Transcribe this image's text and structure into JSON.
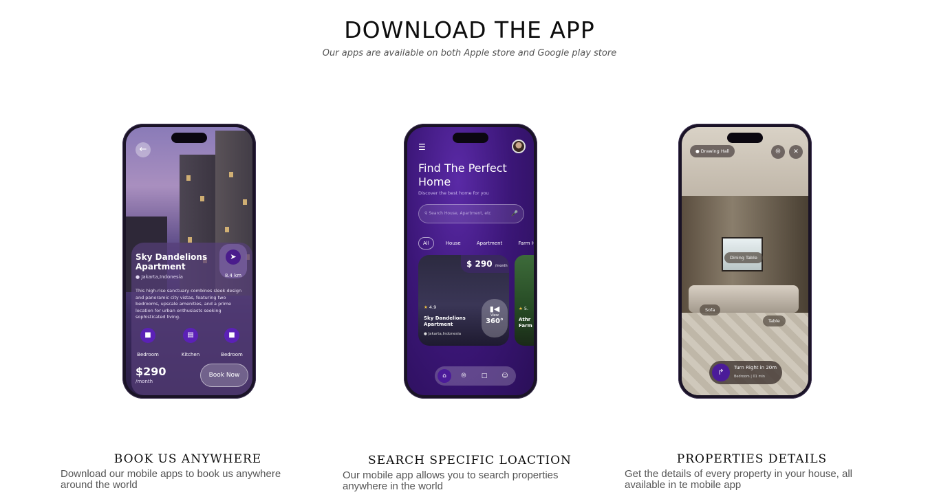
{
  "header": {
    "title": "DOWNLOAD THE APP",
    "subtitle": "Our apps are available on both Apple store and Google play store"
  },
  "phone1": {
    "back_icon": "back-arrow-icon",
    "property_name": "Sky Dandelions Apartment",
    "location": "Jakarta,Indonesia",
    "distance": "8.4 km",
    "description": "This high-rise sanctuary combines sleek design and panoramic city vistas, featuring two bedrooms, upscale amenities, and a prime location for urban enthusiasts seeking sophisticated living.",
    "amenities": [
      {
        "label": "Bedroom",
        "icon": "bed-icon"
      },
      {
        "label": "Kitchen",
        "icon": "kitchen-icon"
      },
      {
        "label": "Bedroom",
        "icon": "bed-icon"
      }
    ],
    "price": "$290",
    "per": "/month",
    "book_label": "Book Now"
  },
  "phone2": {
    "title": "Find The Perfect Home",
    "subtitle": "Discover the best home for you",
    "search_placeholder": "Search House, Apartment, etc",
    "chips": [
      "All",
      "House",
      "Apartment",
      "Farm Hou"
    ],
    "card": {
      "price": "$ 290",
      "per": "/month",
      "rating": "4.9",
      "name": "Sky Dandelions Apartment",
      "location": "Jakarta,Indonesia",
      "view_label": "View",
      "view_value": "360°"
    },
    "card2": {
      "rating": "5.",
      "name": "Athr Farm"
    },
    "nav_icons": [
      "home-icon",
      "compass-icon",
      "chat-icon",
      "user-icon"
    ]
  },
  "phone3": {
    "location_chip": "Drawing Hall",
    "tags": [
      "Dining Table",
      "Sofa",
      "Table"
    ],
    "direction_text": "Turn Right in 20m",
    "direction_room": "Bedroom",
    "direction_time": "01 min"
  },
  "features": [
    {
      "title": "BOOK US ANYWHERE",
      "desc": "Download our mobile apps to book us anywhere around the world"
    },
    {
      "title": "SEARCH SPECIFIC LOACTION",
      "desc": "Our mobile app allows you to search properties anywhere in the world"
    },
    {
      "title": "PROPERTIES DETAILS",
      "desc": "Get the details of every property in your house, all available in te mobile app"
    }
  ]
}
